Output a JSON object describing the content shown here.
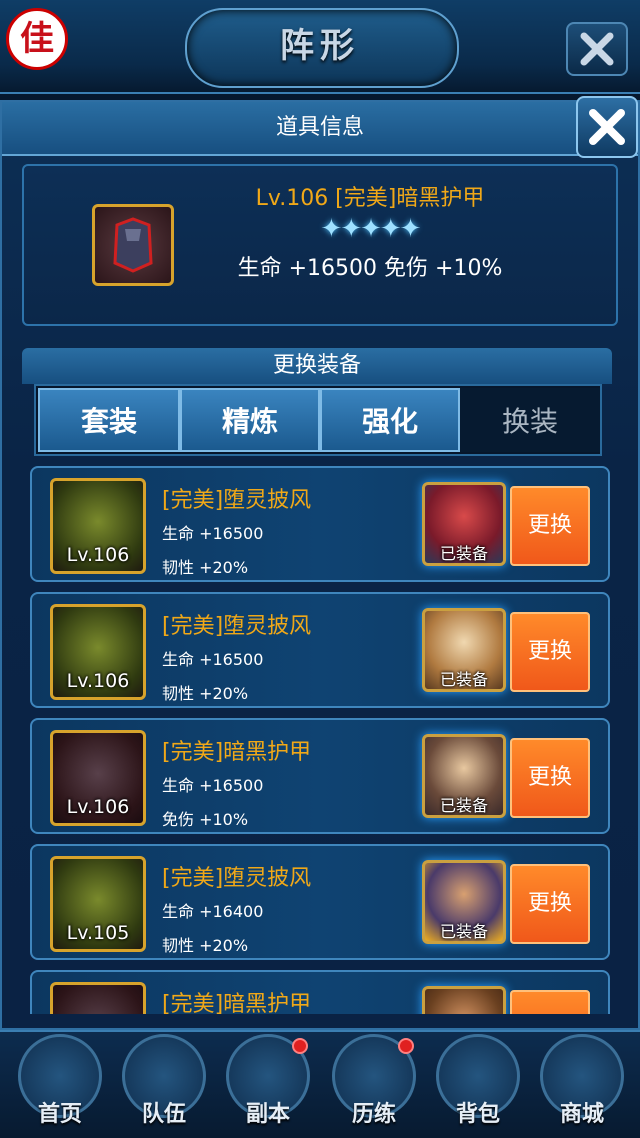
{
  "top_bar": {
    "logo": "佳",
    "title": "阵形",
    "close_icon": "close-icon"
  },
  "panel": {
    "title": "道具信息",
    "close_icon": "close-icon"
  },
  "item_info": {
    "name": "Lv.106 [完美]暗黑护甲",
    "stars": "✦✦✦✦✦",
    "star_count": 5,
    "stats": "生命 +16500  免伤 +10%"
  },
  "swap_section": {
    "title": "更换装备",
    "tabs": [
      {
        "label": "套装",
        "active": false
      },
      {
        "label": "精炼",
        "active": false
      },
      {
        "label": "强化",
        "active": false
      },
      {
        "label": "换装",
        "active": true
      }
    ]
  },
  "equipment_list": [
    {
      "level": "Lv.106",
      "name": "[完美]堕灵披风",
      "stat1": "生命 +16500",
      "stat2": "韧性 +20%",
      "equipped_label": "已装备",
      "button": "更换",
      "type": "cloak"
    },
    {
      "level": "Lv.106",
      "name": "[完美]堕灵披风",
      "stat1": "生命 +16500",
      "stat2": "韧性 +20%",
      "equipped_label": "已装备",
      "button": "更换",
      "type": "cloak"
    },
    {
      "level": "Lv.106",
      "name": "[完美]暗黑护甲",
      "stat1": "生命 +16500",
      "stat2": "免伤 +10%",
      "equipped_label": "已装备",
      "button": "更换",
      "type": "armor"
    },
    {
      "level": "Lv.105",
      "name": "[完美]堕灵披风",
      "stat1": "生命 +16400",
      "stat2": "韧性 +20%",
      "equipped_label": "已装备",
      "button": "更换",
      "type": "cloak"
    },
    {
      "level": "",
      "name": "[完美]暗黑护甲",
      "stat1": "",
      "stat2": "",
      "equipped_label": "",
      "button": "",
      "type": "armor"
    }
  ],
  "bottom_nav": [
    {
      "label": "首页",
      "badge": false
    },
    {
      "label": "队伍",
      "badge": false
    },
    {
      "label": "副本",
      "badge": true
    },
    {
      "label": "历练",
      "badge": true
    },
    {
      "label": "背包",
      "badge": false
    },
    {
      "label": "商城",
      "badge": false
    }
  ],
  "colors": {
    "accent_gold": "#f0a818",
    "button_orange": "#f0581a",
    "panel_blue": "#0a2446"
  }
}
